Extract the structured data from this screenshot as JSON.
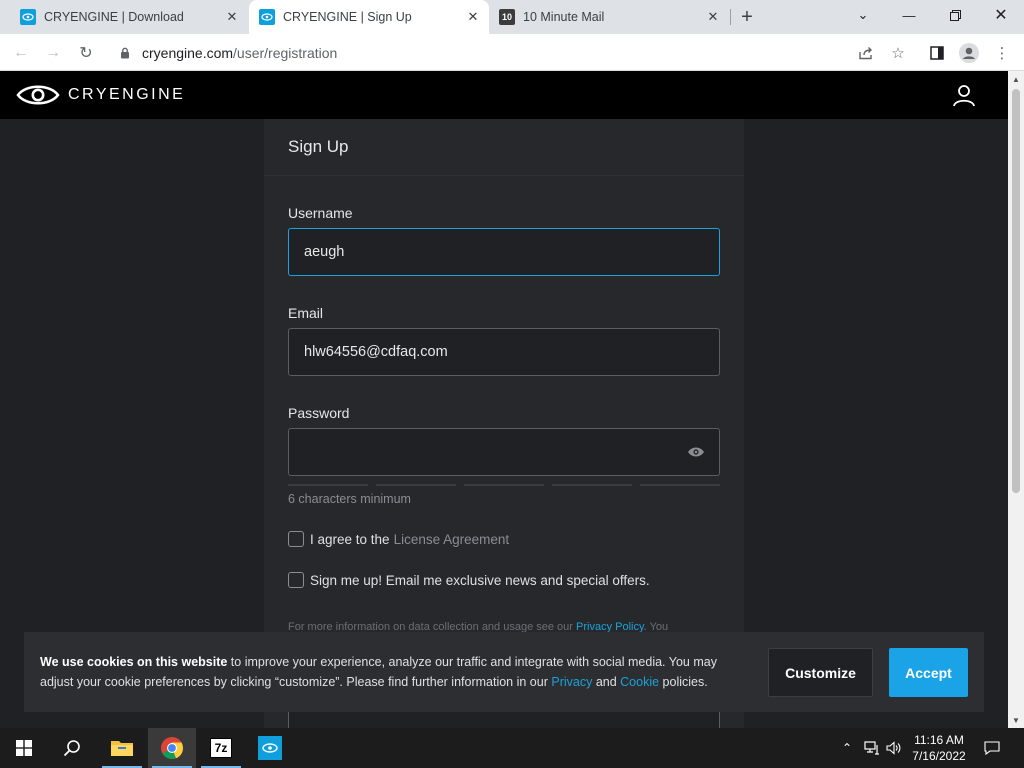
{
  "browser": {
    "tabs": [
      {
        "title": "CRYENGINE | Download",
        "active": false
      },
      {
        "title": "CRYENGINE | Sign Up",
        "active": true
      },
      {
        "title": "10 Minute Mail",
        "active": false
      }
    ],
    "url_domain": "cryengine.com",
    "url_path": "/user/registration"
  },
  "site": {
    "brand": "CRYENGINE",
    "form_title": "Sign Up",
    "username_label": "Username",
    "username_value": "aeugh",
    "email_label": "Email",
    "email_value": "hlw64556@cdfaq.com",
    "password_label": "Password",
    "password_hint": "6 characters minimum",
    "agree_prefix": "I agree to the",
    "agree_link": "License Agreement",
    "newsletter_label": "Sign me up! Email me exclusive news and special offers.",
    "fine_print": "For more information on data collection and usage see our",
    "fine_print_link": "Privacy Policy",
    "fine_print_suffix": ". You"
  },
  "cookie": {
    "bold_lead": "We use cookies on this website",
    "text_1": " to improve your experience, analyze our traffic and integrate with social media. You may adjust your cookie preferences by clicking “customize”. Please find further information in our ",
    "link_privacy": "Privacy",
    "and": " and ",
    "link_cookie": "Cookie",
    "text_2": " policies.",
    "customize_label": "Customize",
    "accept_label": "Accept"
  },
  "taskbar": {
    "time": "11:16 AM",
    "date": "7/16/2022"
  },
  "colors": {
    "accent": "#1aa3e6",
    "page_bg": "#1f2124",
    "card_bg": "#26282c",
    "header_bg": "#000000"
  }
}
